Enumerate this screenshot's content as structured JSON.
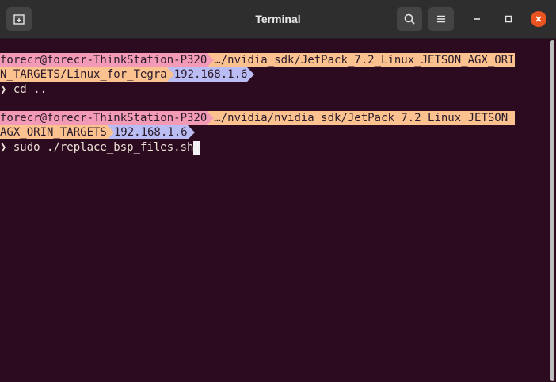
{
  "window": {
    "title": "Terminal",
    "icons": {
      "new_tab": "new-tab-icon",
      "search": "search-icon",
      "menu": "hamburger-menu-icon",
      "minimize": "minimize-icon",
      "maximize": "maximize-icon",
      "close": "close-icon"
    }
  },
  "colors": {
    "background": "#2c0a1f",
    "prompt_user_bg": "#f39ab6",
    "prompt_path_bg": "#fbc18f",
    "prompt_ip_bg": "#b9bdf4",
    "close_button": "#e95420"
  },
  "terminal": {
    "prompt1": {
      "user": "forecr@forecr-ThinkStation-P320",
      "path_line1": "…/nvidia_sdk/JetPack_7.2_Linux_JETSON_AGX_ORI",
      "path_line2": "N_TARGETS/Linux_for_Tegra",
      "ip": "192.168.1.6"
    },
    "command1": {
      "chevron": "❯",
      "text": "cd .."
    },
    "prompt2": {
      "user": "forecr@forecr-ThinkStation-P320",
      "path_line1": "…/nvidia/nvidia_sdk/JetPack_7.2_Linux_JETSON_",
      "path_line2": "AGX_ORIN_TARGETS",
      "ip": "192.168.1.6"
    },
    "command2": {
      "chevron": "❯",
      "text": "sudo ./replace_bsp_files.sh"
    }
  }
}
